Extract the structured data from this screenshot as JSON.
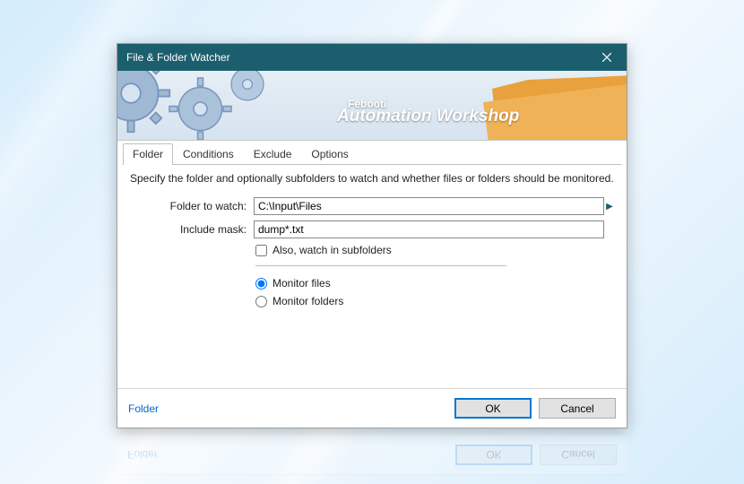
{
  "window": {
    "title": "File & Folder Watcher"
  },
  "banner": {
    "brand": "Febooti",
    "product": "Automation Workshop"
  },
  "tabs": {
    "folder": "Folder",
    "conditions": "Conditions",
    "exclude": "Exclude",
    "options": "Options"
  },
  "panel": {
    "description": "Specify the folder and optionally subfolders to watch and whether files or folders should be monitored.",
    "folder_label": "Folder to watch:",
    "folder_value": "C:\\Input\\Files",
    "mask_label": "Include mask:",
    "mask_value": "dump*.txt",
    "subfolders_label": "Also, watch in subfolders",
    "monitor_files_label": "Monitor files",
    "monitor_folders_label": "Monitor folders"
  },
  "footer": {
    "help_link": "Folder",
    "ok": "OK",
    "cancel": "Cancel"
  }
}
